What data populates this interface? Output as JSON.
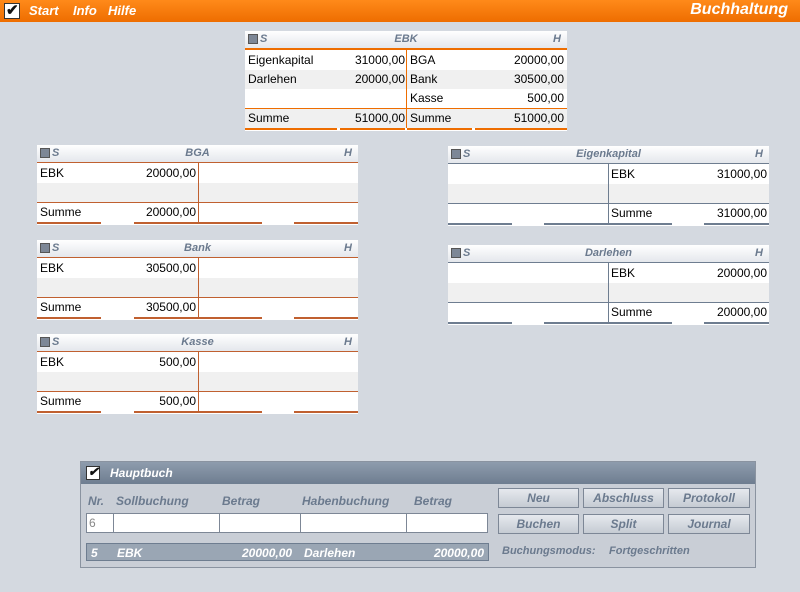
{
  "menu": {
    "start": "Start",
    "info": "Info",
    "hilfe": "Hilfe",
    "title": "Buchhaltung"
  },
  "ebk": {
    "name": "EBK",
    "s": "S",
    "h": "H",
    "left": [
      {
        "label": "Eigenkapital",
        "value": "31000,00"
      },
      {
        "label": "Darlehen",
        "value": "20000,00"
      }
    ],
    "right": [
      {
        "label": "BGA",
        "value": "20000,00"
      },
      {
        "label": "Bank",
        "value": "30500,00"
      },
      {
        "label": "Kasse",
        "value": "500,00"
      }
    ],
    "sum_label": "Summe",
    "sum_left": "51000,00",
    "sum_right": "51000,00"
  },
  "bga": {
    "name": "BGA",
    "s": "S",
    "h": "H",
    "label": "EBK",
    "value": "20000,00",
    "sum_label": "Summe",
    "sum": "20000,00"
  },
  "bank": {
    "name": "Bank",
    "s": "S",
    "h": "H",
    "label": "EBK",
    "value": "30500,00",
    "sum_label": "Summe",
    "sum": "30500,00"
  },
  "kasse": {
    "name": "Kasse",
    "s": "S",
    "h": "H",
    "label": "EBK",
    "value": "500,00",
    "sum_label": "Summe",
    "sum": "500,00"
  },
  "eigenkapital": {
    "name": "Eigenkapital",
    "s": "S",
    "h": "H",
    "label": "EBK",
    "value": "31000,00",
    "sum_label": "Summe",
    "sum": "31000,00"
  },
  "darlehen": {
    "name": "Darlehen",
    "s": "S",
    "h": "H",
    "label": "EBK",
    "value": "20000,00",
    "sum_label": "Summe",
    "sum": "20000,00"
  },
  "hauptbuch": {
    "title": "Hauptbuch",
    "nr": "Nr.",
    "soll": "Sollbuchung",
    "betrag1": "Betrag",
    "haben": "Habenbuchung",
    "betrag2": "Betrag",
    "nr_value": "6",
    "buttons": {
      "neu": "Neu",
      "abschluss": "Abschluss",
      "protokoll": "Protokoll",
      "buchen": "Buchen",
      "split": "Split",
      "journal": "Journal"
    },
    "status": {
      "nr": "5",
      "soll": "EBK",
      "betrag1": "20000,00",
      "haben": "Darlehen",
      "betrag2": "20000,00"
    },
    "mode_label": "Buchungsmodus:",
    "mode_value": "Fortgeschritten"
  },
  "colors": {
    "orange": "#ee6d00",
    "blue": "#6e7d90"
  }
}
